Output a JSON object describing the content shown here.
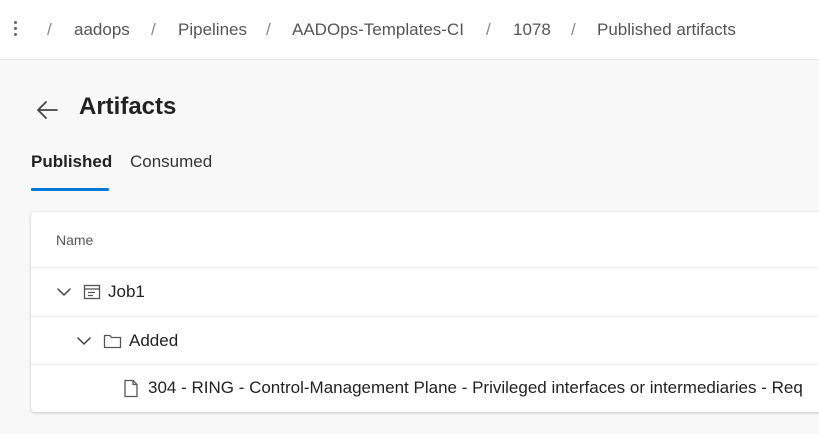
{
  "breadcrumb": {
    "items": [
      "aadops",
      "Pipelines",
      "AADOps-Templates-CI",
      "1078",
      "Published artifacts"
    ],
    "separator": "/"
  },
  "page": {
    "title": "Artifacts"
  },
  "tabs": [
    {
      "label": "Published",
      "active": true
    },
    {
      "label": "Consumed",
      "active": false
    }
  ],
  "table": {
    "column_header": "Name",
    "rows": [
      {
        "label": "Job1",
        "icon": "job-icon",
        "expanded": true
      },
      {
        "label": "Added",
        "icon": "folder-icon",
        "expanded": true
      },
      {
        "label": "304 - RING - Control-Management Plane - Privileged interfaces or intermediaries - Req",
        "icon": "file-icon"
      }
    ]
  },
  "colors": {
    "accent": "#0078d4",
    "background": "#f8f8f8",
    "surface": "#ffffff"
  }
}
